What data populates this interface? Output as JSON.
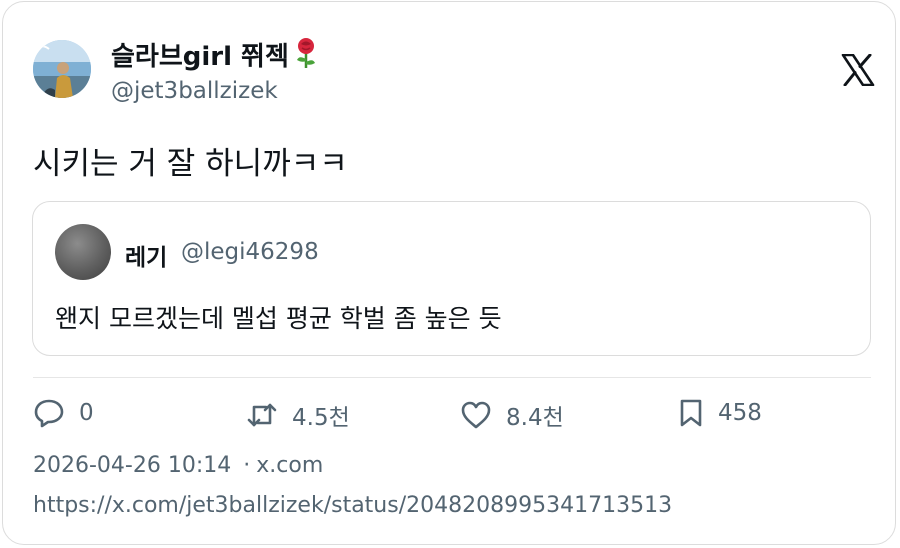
{
  "author": {
    "display_name": "슬라브girl 쮜젝",
    "emoji": "🌹",
    "handle": "@jet3ballzizek"
  },
  "platform_logo": "x-logo-icon",
  "tweet": {
    "text": "시키는 거 잘 하니까ㅋㅋ"
  },
  "quoted_tweet": {
    "display_name": "레기",
    "handle": "@legi46298",
    "text": "왠지 모르겠는데 멜섭 평균 학벌 좀 높은 듯"
  },
  "actions": {
    "replies": "0",
    "retweets": "4.5천",
    "likes": "8.4천",
    "bookmarks": "458"
  },
  "meta": {
    "timestamp": "2026-04-26 10:14",
    "separator": "·",
    "source": "x.com",
    "url": "https://x.com/jet3ballzizek/status/2048208995341713513"
  },
  "colors": {
    "text_primary": "#0f1419",
    "text_secondary": "#536471",
    "border": "#dcdcdc"
  }
}
